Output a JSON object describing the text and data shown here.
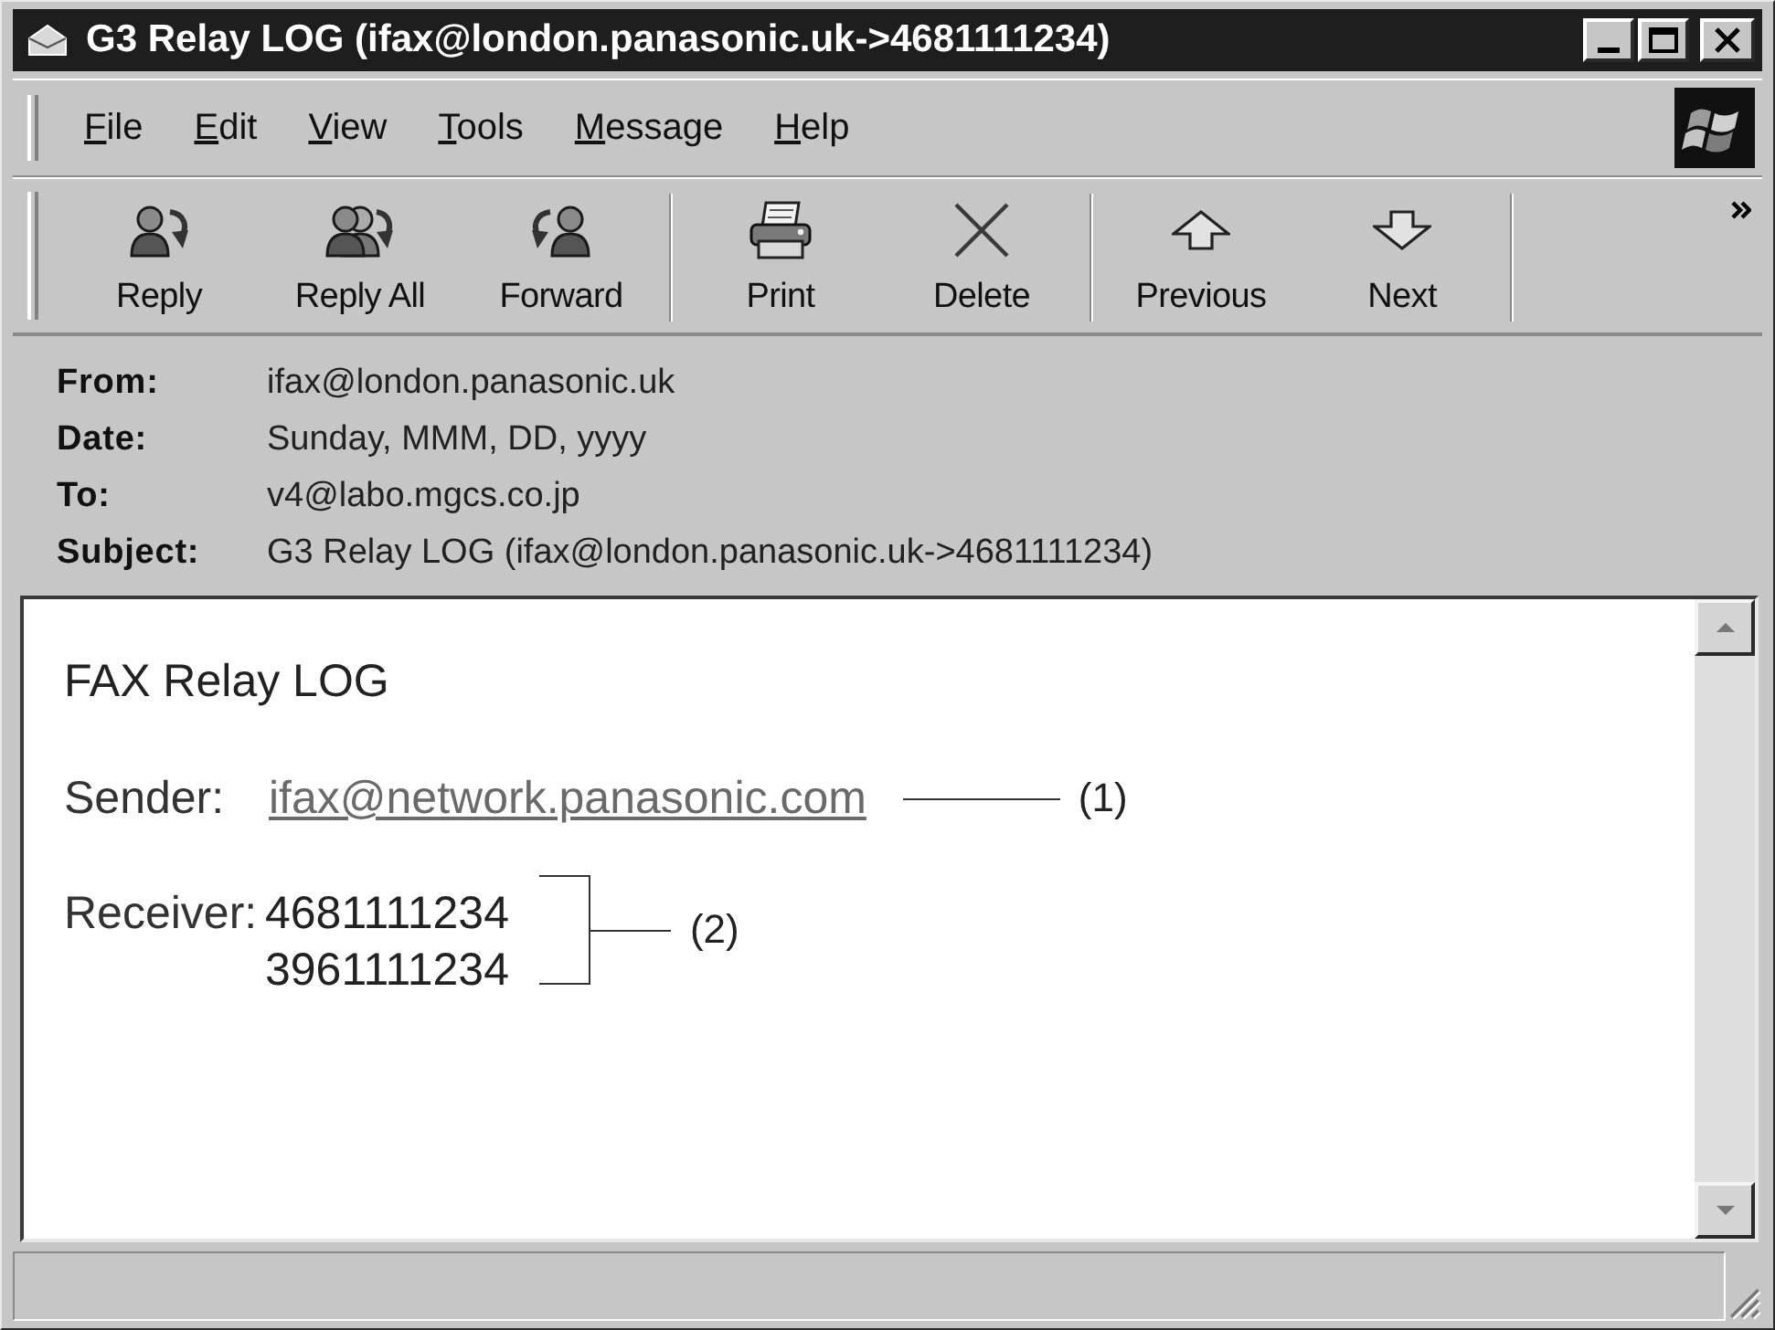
{
  "window": {
    "title": "G3 Relay LOG (ifax@london.panasonic.uk->4681111234)"
  },
  "menu": [
    "File",
    "Edit",
    "View",
    "Tools",
    "Message",
    "Help"
  ],
  "toolbar": [
    {
      "buttons": [
        {
          "label": "Reply",
          "kind": "reply"
        },
        {
          "label": "Reply All",
          "kind": "reply_all"
        },
        {
          "label": "Forward",
          "kind": "forward"
        }
      ]
    },
    {
      "buttons": [
        {
          "label": "Print",
          "kind": "print"
        },
        {
          "label": "Delete",
          "kind": "delete"
        }
      ]
    },
    {
      "buttons": [
        {
          "label": "Previous",
          "kind": "previous"
        },
        {
          "label": "Next",
          "kind": "next"
        }
      ]
    }
  ],
  "header": [
    {
      "label": "From:",
      "value": "ifax@london.panasonic.uk"
    },
    {
      "label": "Date:",
      "value": "Sunday, MMM, DD, yyyy"
    },
    {
      "label": "To:",
      "value": "v4@labo.mgcs.co.jp"
    },
    {
      "label": "Subject:",
      "value": "G3 Relay LOG (ifax@london.panasonic.uk->4681111234)"
    }
  ],
  "message": {
    "title": "FAX Relay LOG",
    "sender": {
      "label": "Sender:",
      "address": "ifax@network.panasonic.com",
      "callout": "(1)"
    },
    "receiver": {
      "label": "Receiver:",
      "numbers": [
        "4681111234",
        "3961111234"
      ],
      "callout": "(2)"
    }
  }
}
